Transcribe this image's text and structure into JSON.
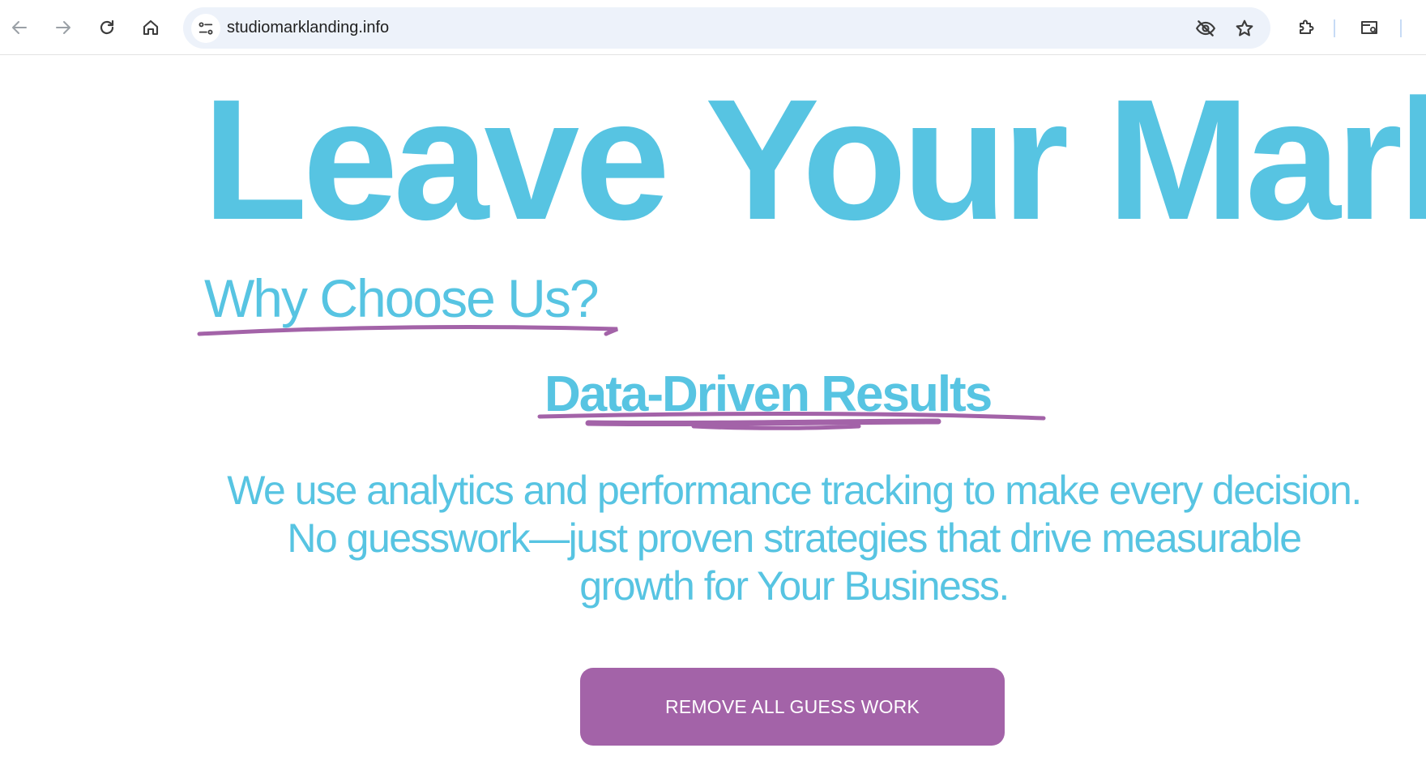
{
  "browser": {
    "url": "studiomarklanding.info",
    "icons": {
      "back": "arrow-left-icon",
      "forward": "arrow-right-icon",
      "reload": "reload-icon",
      "home": "home-icon",
      "site_info": "tune-icon",
      "tracking_protection": "eye-off-icon",
      "bookmark": "star-icon",
      "extensions": "puzzle-icon",
      "reading_mode": "reading-mode-icon"
    }
  },
  "page": {
    "hero_title": "Leave Your Mark",
    "section_title": "Why Choose Us?",
    "subheading": "Data-Driven Results",
    "body": "We use analytics and performance tracking to make every decision. No guesswork—just proven strategies that drive measurable growth for Your Business.",
    "cta_label": "REMOVE ALL GUESS WORK"
  },
  "colors": {
    "accent": "#57c4e2",
    "highlight": "#a363a8",
    "cta_text": "#ffffff",
    "omnibox_bg": "#edf2fa"
  }
}
